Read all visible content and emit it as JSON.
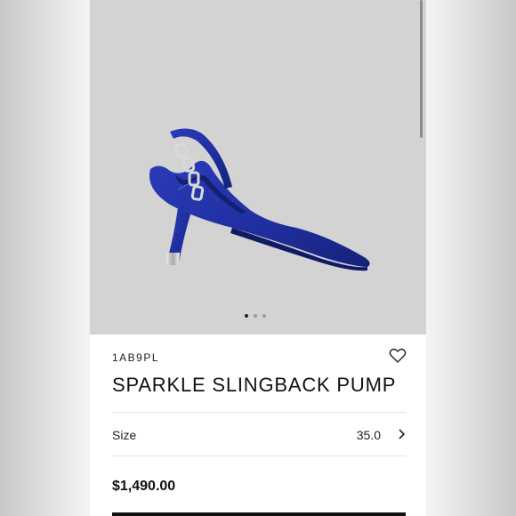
{
  "product": {
    "sku": "1AB9PL",
    "title": "SPARKLE SLINGBACK PUMP",
    "price": "$1,490.00",
    "image_alt": "Blue suede slingback pump with silver chain detail"
  },
  "size": {
    "label": "Size",
    "value": "35.0"
  },
  "carousel": {
    "total": 3,
    "active_index": 0
  },
  "icons": {
    "wishlist": "heart-icon",
    "size_chevron": "chevron-right-icon"
  },
  "colors": {
    "shoe": "#1f2e9e",
    "hero_background": "#d3d3d3"
  }
}
